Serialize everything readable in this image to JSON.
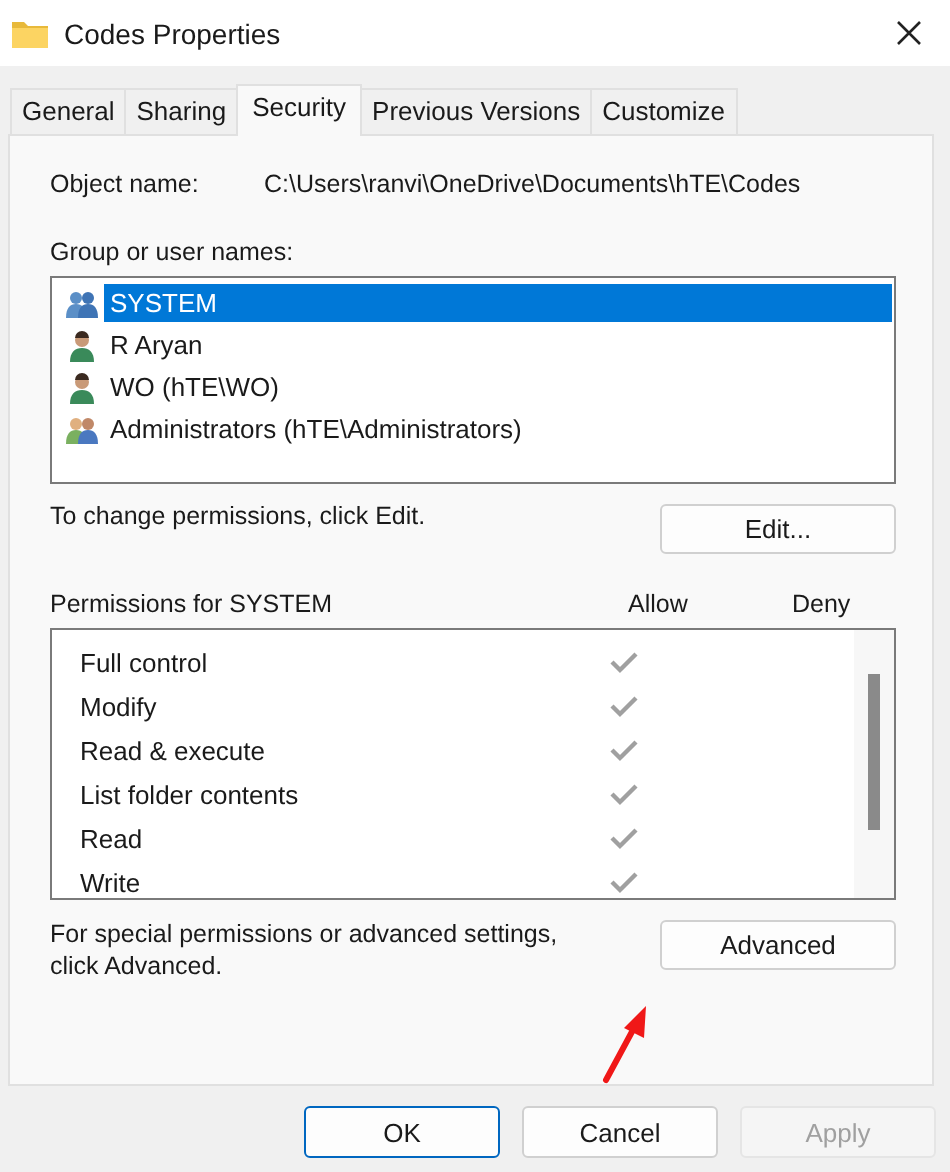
{
  "window": {
    "title": "Codes Properties"
  },
  "tabs": [
    {
      "label": "General",
      "selected": false
    },
    {
      "label": "Sharing",
      "selected": false
    },
    {
      "label": "Security",
      "selected": true
    },
    {
      "label": "Previous Versions",
      "selected": false
    },
    {
      "label": "Customize",
      "selected": false
    }
  ],
  "object_name": {
    "label": "Object name:",
    "value": "C:\\Users\\ranvi\\OneDrive\\Documents\\hTE\\Codes"
  },
  "users": {
    "label": "Group or user names:",
    "items": [
      {
        "name": "SYSTEM",
        "kind": "group",
        "selected": true
      },
      {
        "name": "R Aryan",
        "kind": "user",
        "selected": false
      },
      {
        "name": "WO (hTE\\WO)",
        "kind": "user",
        "selected": false
      },
      {
        "name": "Administrators (hTE\\Administrators)",
        "kind": "admins",
        "selected": false
      }
    ]
  },
  "edit_hint": "To change permissions, click Edit.",
  "edit_button": "Edit...",
  "permissions": {
    "label": "Permissions for SYSTEM",
    "allow_heading": "Allow",
    "deny_heading": "Deny",
    "rows": [
      {
        "name": "Full control",
        "allow": true,
        "deny": false
      },
      {
        "name": "Modify",
        "allow": true,
        "deny": false
      },
      {
        "name": "Read & execute",
        "allow": true,
        "deny": false
      },
      {
        "name": "List folder contents",
        "allow": true,
        "deny": false
      },
      {
        "name": "Read",
        "allow": true,
        "deny": false
      },
      {
        "name": "Write",
        "allow": true,
        "deny": false
      }
    ]
  },
  "advanced_hint": "For special permissions or advanced settings, click Advanced.",
  "advanced_button": "Advanced",
  "buttons": [
    {
      "label": "OK",
      "default": true,
      "disabled": false
    },
    {
      "label": "Cancel",
      "default": false,
      "disabled": false
    },
    {
      "label": "Apply",
      "default": false,
      "disabled": true
    }
  ]
}
